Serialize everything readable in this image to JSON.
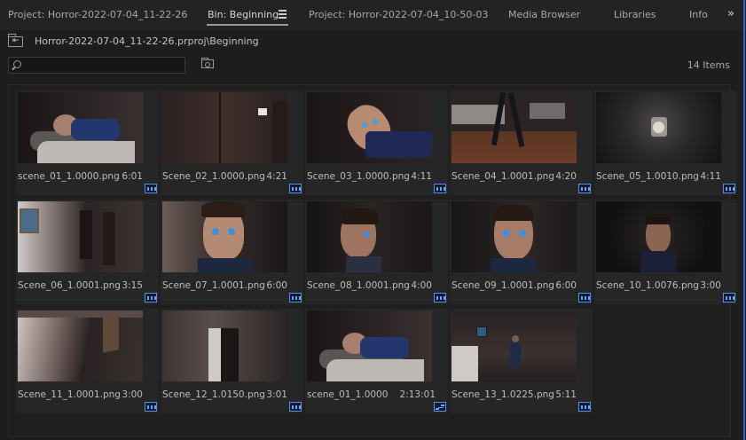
{
  "tabs": [
    {
      "label": "Project: Horror-2022-07-04_11-22-26"
    },
    {
      "label": "Bin: Beginning"
    },
    {
      "label": "Project: Horror-2022-07-04_10-50-03"
    },
    {
      "label": "Media Browser"
    },
    {
      "label": "Libraries"
    },
    {
      "label": "Info"
    }
  ],
  "active_tab": "Bin: Beginning",
  "overflow": "»",
  "path": "Horror-2022-07-04_11-22-26.prproj\\Beginning",
  "search": {
    "value": "",
    "placeholder": ""
  },
  "item_count": "14 Items",
  "items": [
    {
      "name": "scene_01_1.0000.png",
      "duration": "6:01",
      "icon": "film-frames-icon"
    },
    {
      "name": "Scene_02_1.0000.png",
      "duration": "4:21",
      "icon": "film-frames-icon"
    },
    {
      "name": "Scene_03_1.0000.png",
      "duration": "4:11",
      "icon": "film-frames-icon"
    },
    {
      "name": "Scene_04_1.0001.png",
      "duration": "4:20",
      "icon": "film-frames-icon"
    },
    {
      "name": "Scene_05_1.0010.png",
      "duration": "4:11",
      "icon": "film-frames-icon"
    },
    {
      "name": "Scene_06_1.0001.png",
      "duration": "3:15",
      "icon": "film-frames-icon"
    },
    {
      "name": "Scene_07_1.0001.png",
      "duration": "6:00",
      "icon": "film-frames-icon"
    },
    {
      "name": "Scene_08_1.0001.png",
      "duration": "4:00",
      "icon": "film-frames-icon"
    },
    {
      "name": "Scene_09_1.0001.png",
      "duration": "6:00",
      "icon": "film-frames-icon"
    },
    {
      "name": "Scene_10_1.0076.png",
      "duration": "3:00",
      "icon": "film-frames-icon"
    },
    {
      "name": "Scene_11_1.0001.png",
      "duration": "3:00",
      "icon": "film-frames-icon"
    },
    {
      "name": "Scene_12_1.0150.png",
      "duration": "3:01",
      "icon": "film-frames-icon"
    },
    {
      "name": "scene_01_1.0000",
      "duration": "2:13:01",
      "icon": "sequence-icon"
    },
    {
      "name": "Scene_13_1.0225.png",
      "duration": "5:11",
      "icon": "film-frames-icon"
    }
  ],
  "colors": {
    "accent": "#2f65c9",
    "badge": "#6fa2f4",
    "background": "#1d1d1d"
  }
}
